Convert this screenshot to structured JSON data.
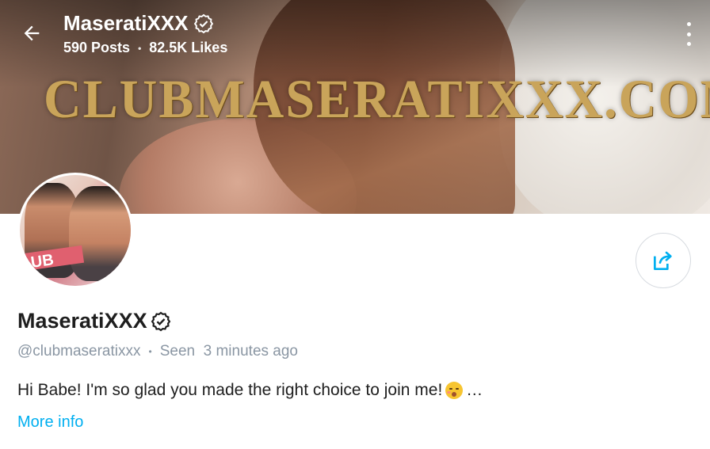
{
  "header": {
    "name": "MaseratiXXX",
    "posts": "590 Posts",
    "separator": "•",
    "likes": "82.5K Likes"
  },
  "banner": {
    "watermark": "CLUBMASERATIXXX.COM"
  },
  "avatar": {
    "text": "UB"
  },
  "profile": {
    "name": "MaseratiXXX",
    "handle": "@clubmaseratixxx",
    "separator": "•",
    "seen": "Seen  3 minutes ago",
    "bio": "Hi Babe! I'm so glad you made the right choice to join me!",
    "bio_ellipsis": "…",
    "more_info": "More info"
  },
  "colors": {
    "accent": "#00aff0",
    "muted": "#8a96a3",
    "text": "#1e1e1e"
  },
  "icons": {
    "back": "back-arrow-icon",
    "more": "more-vertical-icon",
    "verified": "verified-badge-icon",
    "share": "share-icon"
  }
}
